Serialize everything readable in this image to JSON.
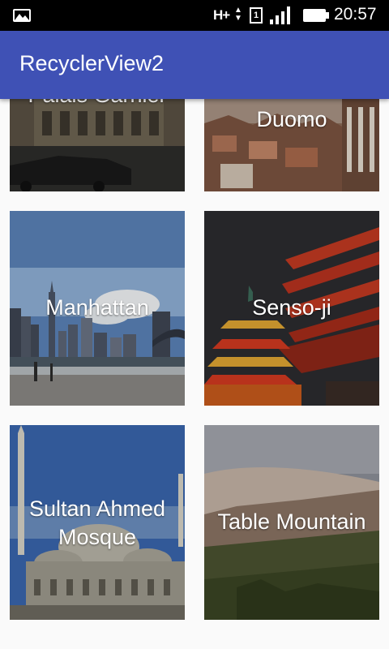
{
  "status_bar": {
    "network": "H+",
    "sim": "1",
    "time": "20:57"
  },
  "app_bar": {
    "title": "RecyclerView2"
  },
  "cards": [
    {
      "label": "Palais Garnier",
      "image": "palais-garnier-photo"
    },
    {
      "label": "Duomo",
      "image": "duomo-photo"
    },
    {
      "label": "Manhattan",
      "image": "manhattan-photo"
    },
    {
      "label": "Senso-ji",
      "image": "senso-ji-photo"
    },
    {
      "label": "Sultan Ahmed Mosque",
      "image": "sultan-ahmed-mosque-photo"
    },
    {
      "label": "Table Mountain",
      "image": "table-mountain-photo"
    }
  ],
  "colors": {
    "app_bar": "#3f51b5",
    "status_bar": "#000000",
    "background": "#fafafa"
  }
}
